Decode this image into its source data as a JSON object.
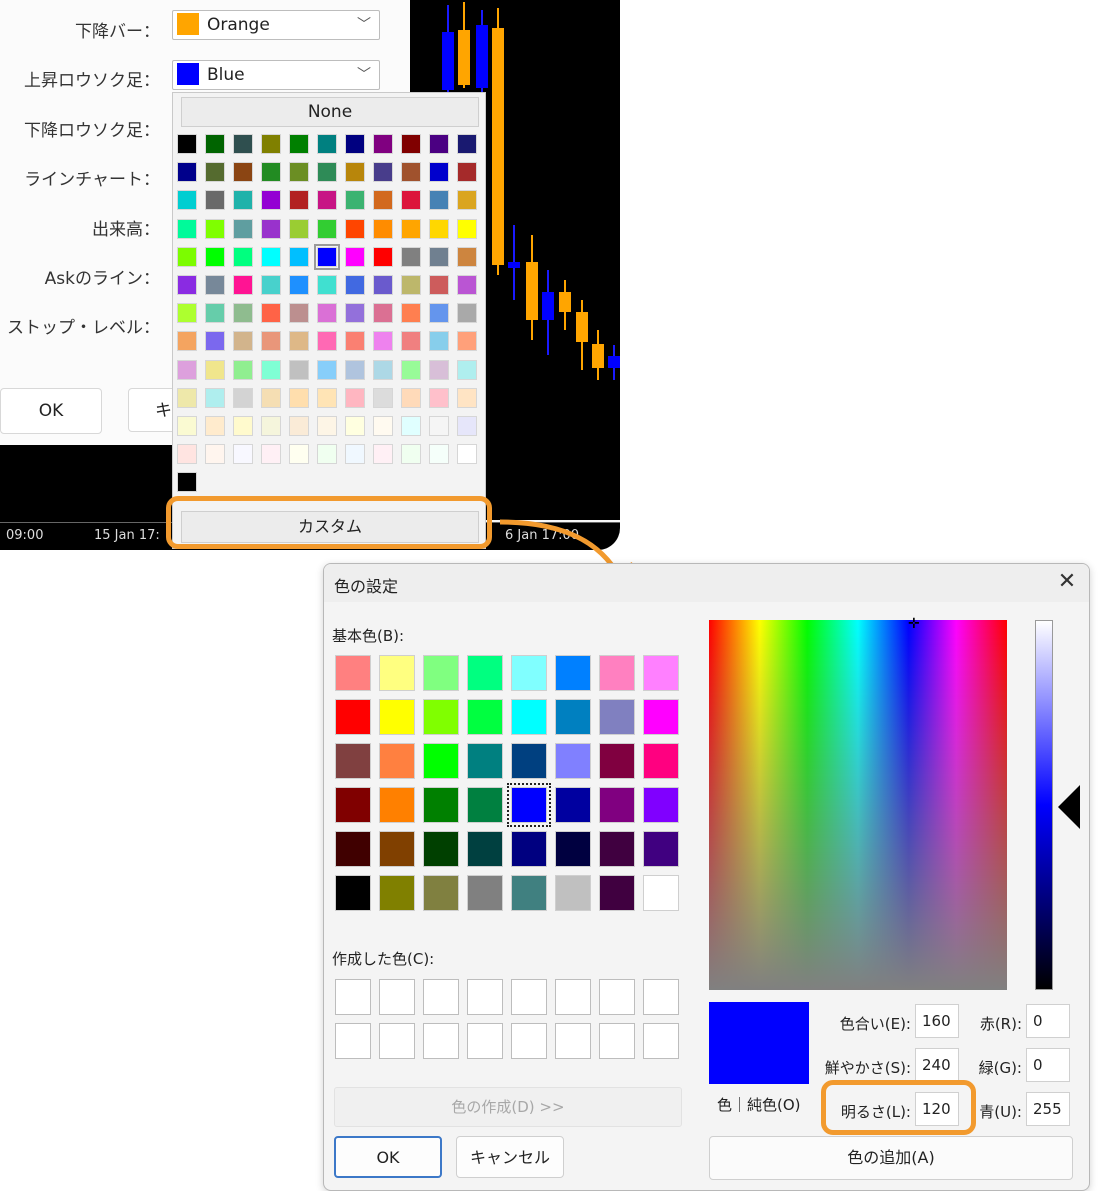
{
  "settings": {
    "rows": [
      {
        "label": "下降バー：",
        "value": "Orange",
        "color": "#ffa500"
      },
      {
        "label": "上昇ロウソク足：",
        "value": "Blue",
        "color": "#0000ff"
      },
      {
        "label": "下降ロウソク足："
      },
      {
        "label": "ラインチャート："
      },
      {
        "label": "出来高："
      },
      {
        "label": "Askのライン："
      },
      {
        "label": "ストップ・レベル："
      }
    ],
    "ok_label": "OK",
    "cancel_partial": "キ"
  },
  "chart": {
    "time_labels": [
      "09:00",
      "15 Jan 17:",
      "6 Jan 17:00"
    ],
    "up_color": "#0000ff",
    "down_color": "#ffa500"
  },
  "palette": {
    "none_label": "None",
    "custom_label": "カスタム",
    "rows": [
      [
        "#000000",
        "#006400",
        "#2f4f4f",
        "#808000",
        "#008000",
        "#008080",
        "#000080",
        "#800080",
        "#800000",
        "#4b0082",
        "#191970"
      ],
      [
        "#00008b",
        "#556b2f",
        "#8b4513",
        "#228b22",
        "#6b8e23",
        "#2e8b57",
        "#b8860b",
        "#483d8b",
        "#a0522d",
        "#0000cd",
        "#a52a2a"
      ],
      [
        "#00ced1",
        "#696969",
        "#20b2aa",
        "#9400d3",
        "#b22222",
        "#c71585",
        "#3cb371",
        "#d2691e",
        "#dc143c",
        "#4682b4",
        "#daa520"
      ],
      [
        "#00fa9a",
        "#7fff00",
        "#5f9ea0",
        "#9932cc",
        "#9acd32",
        "#32cd32",
        "#ff4500",
        "#ff8c00",
        "#ffa500",
        "#ffd700",
        "#ffff00"
      ],
      [
        "#7cfc00",
        "#00ff00",
        "#00ff7f",
        "#00ffff",
        "#00bfff",
        "#0000ff",
        "#ff00ff",
        "#ff0000",
        "#808080",
        "#708090",
        "#cd853f"
      ],
      [
        "#8a2be2",
        "#778899",
        "#ff1493",
        "#48d1cc",
        "#1e90ff",
        "#40e0d0",
        "#4169e1",
        "#6a5acd",
        "#bdb76b",
        "#cd5c5c",
        "#ba55d3"
      ],
      [
        "#adff2f",
        "#66cdaa",
        "#8fbc8f",
        "#ff6347",
        "#bc8f8f",
        "#da70d6",
        "#9370db",
        "#db7093",
        "#ff7f50",
        "#6495ed",
        "#a9a9a9"
      ],
      [
        "#f4a460",
        "#7b68ee",
        "#d2b48c",
        "#e9967a",
        "#deb887",
        "#ff69b4",
        "#fa8072",
        "#ee82ee",
        "#f08080",
        "#87ceeb",
        "#ffa07a"
      ],
      [
        "#dda0dd",
        "#f0e68c",
        "#90ee90",
        "#7fffd4",
        "#c0c0c0",
        "#87cefa",
        "#b0c4de",
        "#add8e6",
        "#98fb98",
        "#d8bfd8",
        "#afeeee"
      ],
      [
        "#eee8aa",
        "#afeeee",
        "#d3d3d3",
        "#f5deb3",
        "#ffdead",
        "#ffe4b5",
        "#ffb6c1",
        "#dcdcdc",
        "#ffdab9",
        "#ffc0cb",
        "#ffe4c4"
      ],
      [
        "#fafad2",
        "#ffebcd",
        "#fffacd",
        "#f5f5dc",
        "#faebd7",
        "#fdf5e6",
        "#ffffe0",
        "#fffaf0",
        "#e0ffff",
        "#f5f5f5",
        "#e6e6fa"
      ],
      [
        "#ffe4e1",
        "#fff5ee",
        "#f8f8ff",
        "#fff0f5",
        "#fffff0",
        "#f0fff0",
        "#f0f8ff",
        "#fff0f5",
        "#f0fff0",
        "#f5fffa",
        "#ffffff"
      ],
      [
        "#000000"
      ]
    ]
  },
  "dialog": {
    "title": "色の設定",
    "close_glyph": "✕",
    "basic_label": "基本色(B):",
    "basic_colors": [
      [
        "#ff8080",
        "#ffff80",
        "#80ff80",
        "#00ff80",
        "#80ffff",
        "#0080ff",
        "#ff80c0",
        "#ff80ff"
      ],
      [
        "#ff0000",
        "#ffff00",
        "#80ff00",
        "#00ff40",
        "#00ffff",
        "#0080c0",
        "#8080c0",
        "#ff00ff"
      ],
      [
        "#804040",
        "#ff8040",
        "#00ff00",
        "#008080",
        "#004080",
        "#8080ff",
        "#800040",
        "#ff0080"
      ],
      [
        "#800000",
        "#ff8000",
        "#008000",
        "#008040",
        "#0000ff",
        "#0000a0",
        "#800080",
        "#8000ff"
      ],
      [
        "#400000",
        "#804000",
        "#004000",
        "#004040",
        "#000080",
        "#000040",
        "#400040",
        "#400080"
      ],
      [
        "#000000",
        "#808000",
        "#808040",
        "#808080",
        "#408080",
        "#c0c0c0",
        "#400040",
        "#ffffff"
      ]
    ],
    "custom_label": "作成した色(C):",
    "define_label": "色の作成(D) >>",
    "ok_label": "OK",
    "cancel_label": "キャンセル",
    "preview_label": "色｜純色(O)",
    "preview_color": "#0000ff",
    "hue_label": "色合い(E):",
    "hue": "160",
    "sat_label": "鮮やかさ(S):",
    "sat": "240",
    "lum_label": "明るさ(L):",
    "lum": "120",
    "red_label": "赤(R):",
    "red": "0",
    "green_label": "緑(G):",
    "green": "0",
    "blue_label": "青(U):",
    "blue": "255",
    "add_label": "色の追加(A)",
    "crosshair_glyph": "✛"
  }
}
